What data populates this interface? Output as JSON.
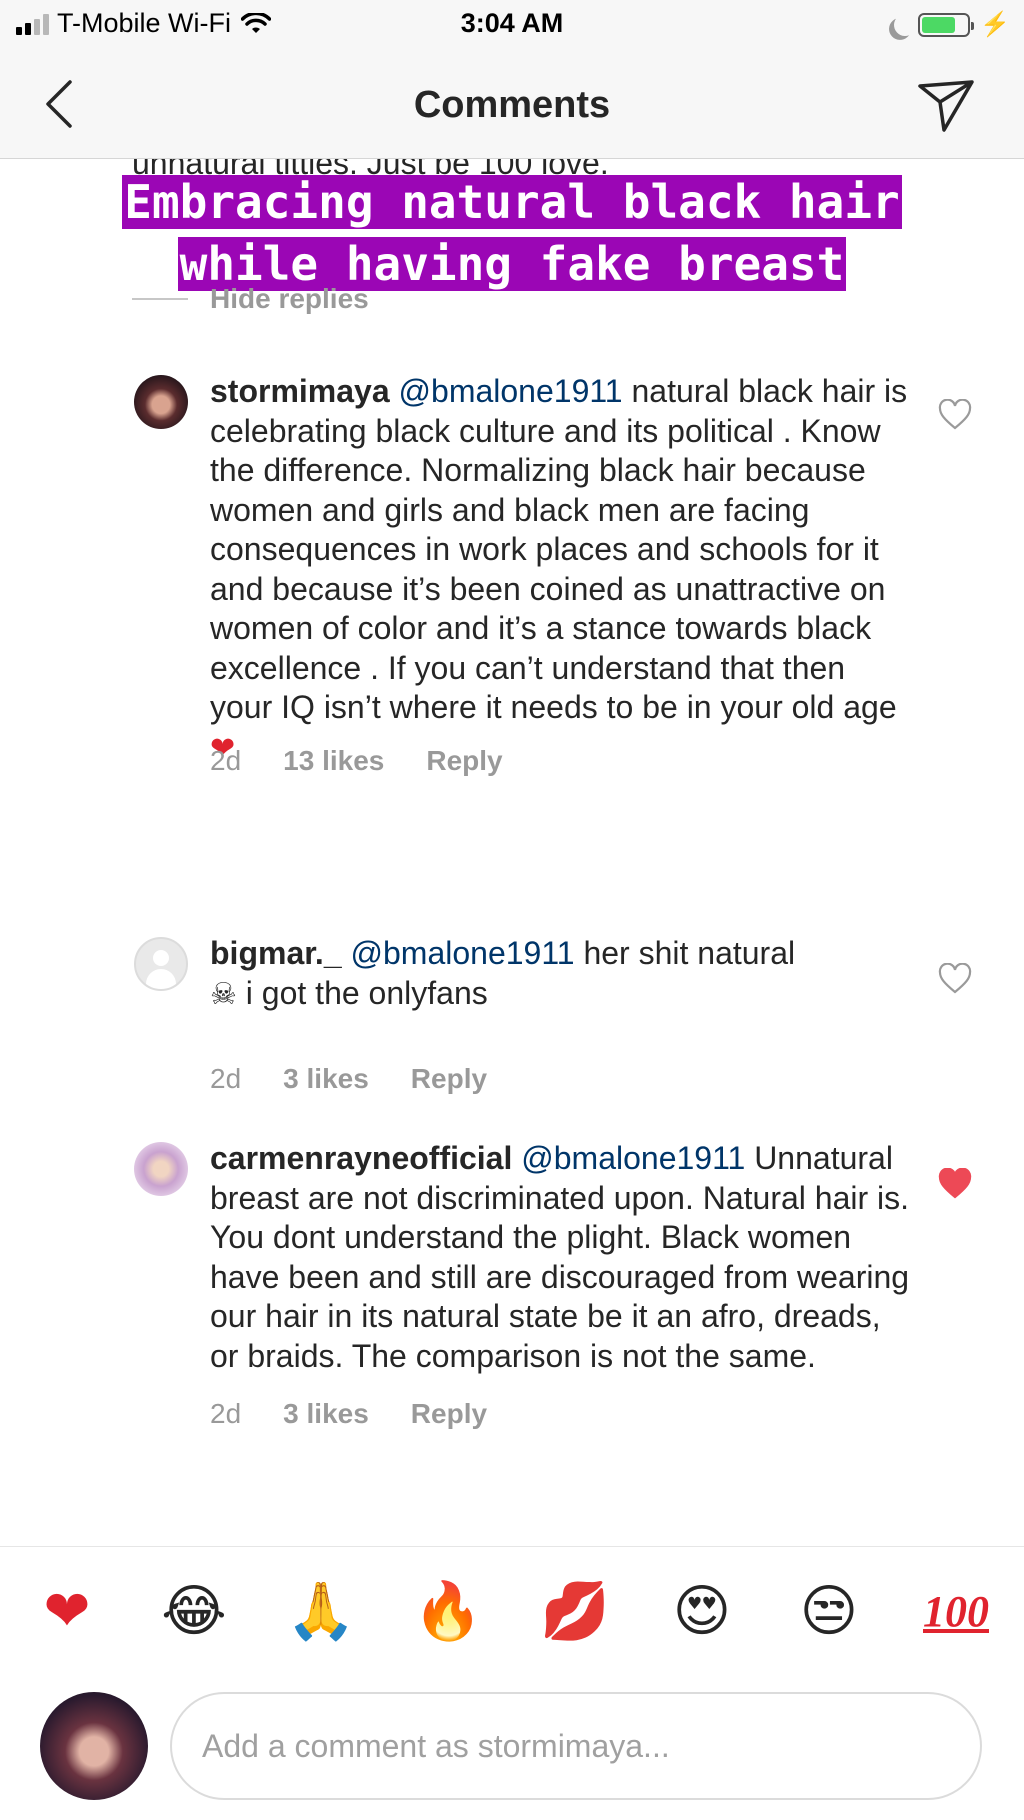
{
  "status_bar": {
    "carrier": "T-Mobile Wi-Fi",
    "time": "3:04 AM",
    "battery_level": 0.75,
    "battery_color": "#4cd964"
  },
  "nav": {
    "title": "Comments",
    "back_icon": "chevron-left-icon",
    "send_icon": "paper-plane-icon"
  },
  "partial_text": "unnatural titties.  Just be 100 love.",
  "overlay": {
    "line1": "Embracing natural black hair",
    "line2": "while having fake breast",
    "background": "#9b06b5"
  },
  "hide_replies": "Hide replies",
  "comments": [
    {
      "username": "stormimaya",
      "mention": "@bmalone1911",
      "text": " natural black hair is celebrating black culture and its political . Know the difference. Normalizing black hair because women and girls and black men are facing consequences in work places and schools for it and because it’s been coined as unattractive on women of color and it’s a stance towards black excellence . If you can’t understand that then your IQ isn’t where it needs to be in your old age ",
      "emoji": "❤",
      "time": "2d",
      "likes": "13 likes",
      "reply": "Reply",
      "liked": false
    },
    {
      "username": "bigmar._",
      "mention": "@bmalone1911",
      "text": " her shit natural ",
      "emoji": "☠",
      "text_after": " i got the onlyfans",
      "time": "2d",
      "likes": "3 likes",
      "reply": "Reply",
      "liked": false
    },
    {
      "username": "carmenrayneofficial",
      "mention": "@bmalone1911",
      "text": " Unnatural breast are not discriminated upon. Natural hair is. You dont understand the plight. Black women have been and still are discouraged from wearing our hair in its natural state be it an afro, dreads, or braids. The comparison is not the same.",
      "time": "2d",
      "likes": "3 likes",
      "reply": "Reply",
      "liked": true
    }
  ],
  "reactions": [
    "❤",
    "😂",
    "🙏",
    "🔥",
    "💋",
    "😍",
    "😒",
    "100"
  ],
  "compose": {
    "placeholder": "Add a comment as stormimaya..."
  },
  "colors": {
    "mention": "#003569",
    "muted": "#999999",
    "like_red": "#ed4956"
  }
}
